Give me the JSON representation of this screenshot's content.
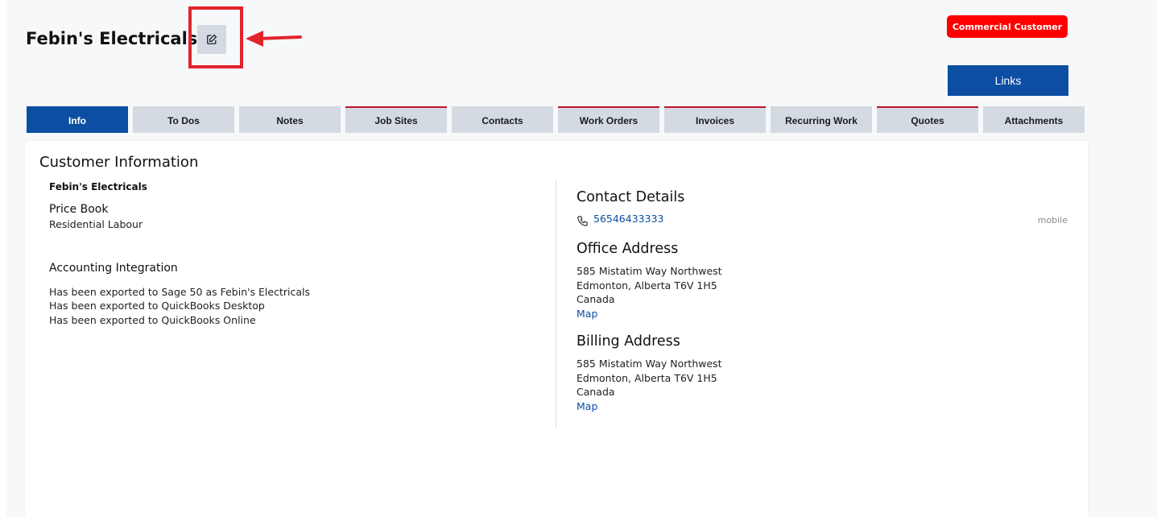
{
  "header": {
    "title": "Febin's Electricals",
    "edit_icon": "edit-icon",
    "badge": "Commercial Customer",
    "links_label": "Links"
  },
  "tabs": [
    {
      "label": "Info",
      "active": true
    },
    {
      "label": "To Dos"
    },
    {
      "label": "Notes"
    },
    {
      "label": "Job Sites"
    },
    {
      "label": "Contacts"
    },
    {
      "label": "Work Orders"
    },
    {
      "label": "Invoices"
    },
    {
      "label": "Recurring Work"
    },
    {
      "label": "Quotes"
    },
    {
      "label": "Attachments"
    }
  ],
  "customer_info": {
    "heading": "Customer Information",
    "name": "Febin's Electricals",
    "price_book_label": "Price Book",
    "price_book_value": "Residential Labour",
    "accounting_heading": "Accounting Integration",
    "accounting_lines": [
      "Has been exported to Sage 50 as Febin's Electricals",
      "Has been exported to QuickBooks Desktop",
      "Has been exported to QuickBooks Online"
    ]
  },
  "contact": {
    "heading": "Contact Details",
    "phone_icon": "phone-icon",
    "phone": "56546433333",
    "phone_type": "mobile"
  },
  "office_address": {
    "heading": "Office Address",
    "line1": "585 Mistatim Way Northwest",
    "line2": "Edmonton, Alberta T6V 1H5",
    "line3": "Canada",
    "map_label": "Map"
  },
  "billing_address": {
    "heading": "Billing Address",
    "line1": "585 Mistatim Way Northwest",
    "line2": "Edmonton, Alberta T6V 1H5",
    "line3": "Canada",
    "map_label": "Map"
  },
  "colors": {
    "primary": "#0c4ea2",
    "badge": "#ff0000",
    "tab_inactive": "#d3dae2",
    "tab_marker": "#c8102e",
    "annotation": "#e2232a"
  }
}
